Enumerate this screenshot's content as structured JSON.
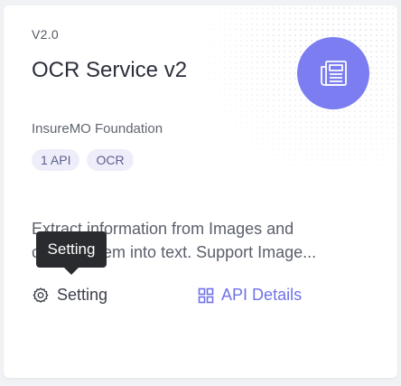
{
  "card": {
    "version": "V2.0",
    "title": "OCR Service v2",
    "icon": "newspaper-icon",
    "provider": "InsureMO Foundation",
    "tags": [
      "1 API",
      "OCR"
    ],
    "description": "Extract information from Images and convert them into text. Support Image...",
    "tooltip": "Setting",
    "actions": {
      "setting_label": "Setting",
      "setting_icon": "gear-icon",
      "api_label": "API Details",
      "api_icon": "grid-icon"
    }
  },
  "colors": {
    "accent": "#7b7df0",
    "link": "#6f72e8",
    "tag_bg": "#eeeefa",
    "tooltip_bg": "#2a2b2f"
  }
}
